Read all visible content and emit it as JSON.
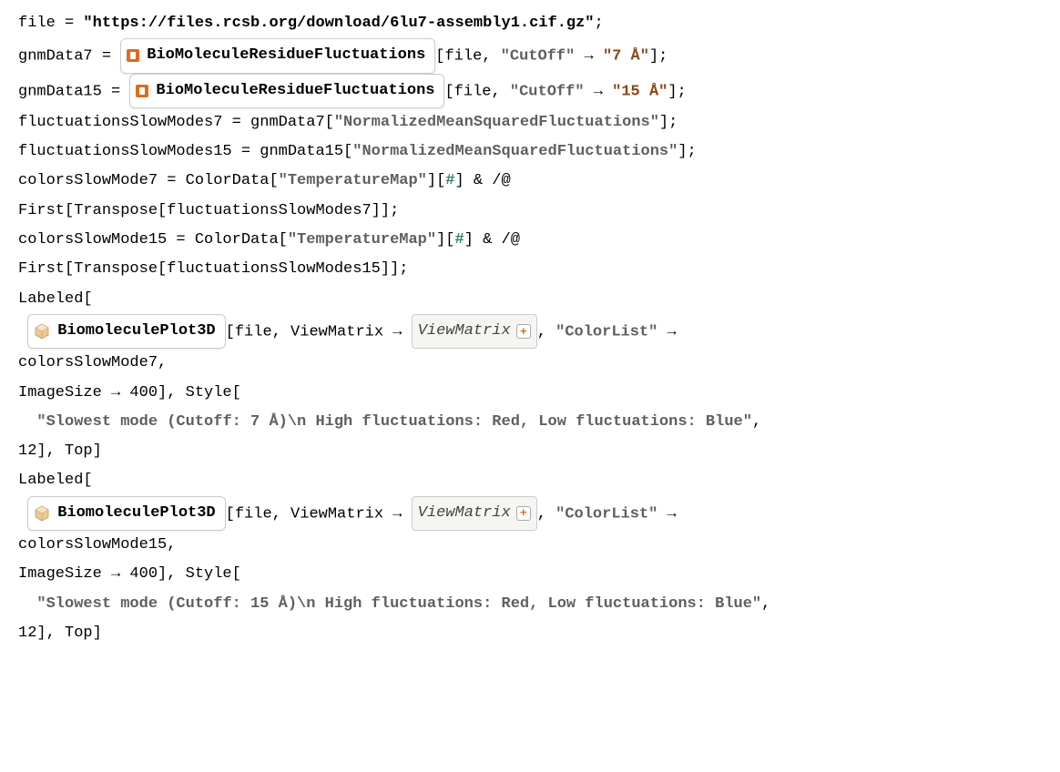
{
  "code": {
    "line1_prefix": "file = ",
    "line1_url": "\"https://files.rcsb.org/download/6lu7-assembly1.cif.gz\"",
    "line1_suffix": ";",
    "line2_prefix": "gnmData7 = ",
    "resource_fn": "BioMoleculeResidueFluctuations",
    "line2_mid": "[file, ",
    "cutoff_key": "\"CutOff\"",
    "arrow": " → ",
    "cutoff7_val": "\"7 Å\"",
    "line2_suffix": "];",
    "line3_prefix": "gnmData15 = ",
    "cutoff15_val": "\"15 Å\"",
    "line3_suffix": "];",
    "line4": "fluctuationsSlowModes7 = gnmData7[",
    "nmsf": "\"NormalizedMeanSquaredFluctuations\"",
    "line4_suffix": "];",
    "line5": "fluctuationsSlowModes15 = gnmData15[",
    "line6_prefix": "colorsSlowMode7 = ColorData[",
    "tempmap": "\"TemperatureMap\"",
    "line6_mid": "][",
    "hash": "#",
    "line6_suffix": "] & /@",
    "line7": "   First[Transpose[fluctuationsSlowModes7]];",
    "line8_prefix": "colorsSlowMode15 = ColorData[",
    "line9": "   First[Transpose[fluctuationsSlowModes15]];",
    "line10": "Labeled[",
    "paclet_fn": "BiomoleculePlot3D",
    "line11_mid": "[file, ViewMatrix → ",
    "viewmatrix_label": "ViewMatrix",
    "colorlist_key": "\"ColorList\"",
    "line11_suffix": " →",
    "line12": "  colorsSlowMode7,",
    "line13": "  ImageSize → 400], Style[",
    "label7": "\"Slowest mode (Cutoff: 7 Å)\\n High fluctuations: Red, Low fluctuations: Blue\"",
    "line14": ",",
    "line15": "  12], Top]",
    "line16": "Labeled[",
    "line17_suffix": " →",
    "line18": "  colorsSlowMode15,",
    "line19": "  ImageSize → 400], Style[",
    "label15": "\"Slowest mode (Cutoff: 15 Å)\\n High fluctuations: Red, Low fluctuations: Blue\"",
    "line20": ",",
    "line21": "  12], Top]"
  }
}
